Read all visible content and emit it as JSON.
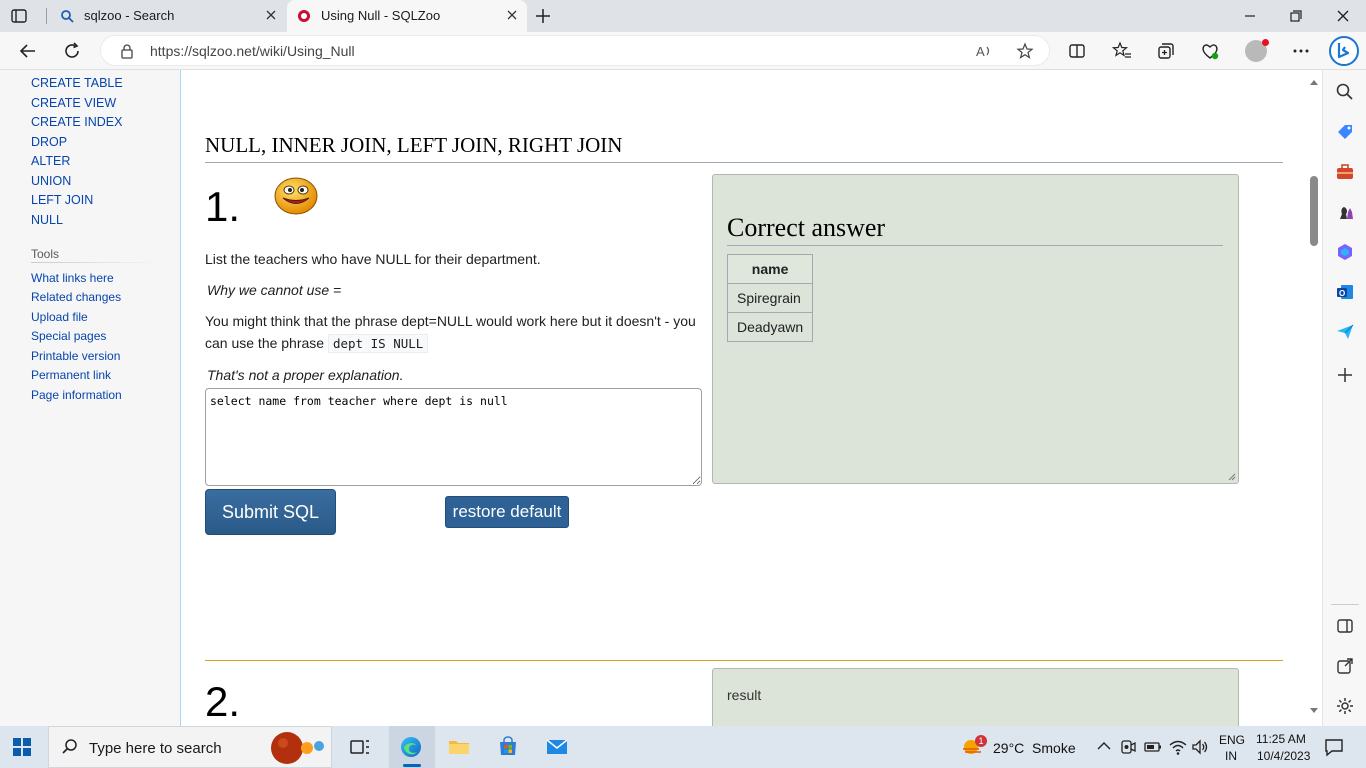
{
  "browser": {
    "tabs": [
      {
        "title": "sqlzoo - Search",
        "active": false
      },
      {
        "title": "Using Null - SQLZoo",
        "active": true
      }
    ],
    "url": "https://sqlzoo.net/wiki/Using_Null"
  },
  "left_nav": {
    "links": [
      "CREATE TABLE",
      "CREATE VIEW",
      "CREATE INDEX",
      "DROP",
      "ALTER",
      "UNION",
      "LEFT JOIN",
      "NULL"
    ],
    "tools_title": "Tools",
    "tools": [
      "What links here",
      "Related changes",
      "Upload file",
      "Special pages",
      "Printable version",
      "Permanent link",
      "Page information"
    ]
  },
  "content": {
    "section_title": "NULL, INNER JOIN, LEFT JOIN, RIGHT JOIN",
    "q1": {
      "number": "1.",
      "prompt": "List the teachers who have NULL for their department.",
      "why_label": "Why we cannot use =",
      "explanation_part1": "You might think that the phrase dept=NULL would work here but it doesn't - you can use the phrase",
      "explanation_code": "dept IS NULL",
      "not_proper": "That's not a proper explanation.",
      "sql": "select name from teacher where dept is null",
      "submit_label": "Submit SQL",
      "restore_label": "restore default",
      "answer": {
        "title": "Correct answer",
        "header": "name",
        "rows": [
          "Spiregrain",
          "Deadyawn"
        ]
      }
    },
    "q2": {
      "number": "2.",
      "result_label": "result"
    }
  },
  "taskbar": {
    "search_placeholder": "Type here to search",
    "weather": "29°C  Smoke",
    "weather_badge": "1",
    "lang": "ENG",
    "region": "IN",
    "time": "11:25 AM",
    "date": "10/4/2023"
  },
  "colors": {
    "link": "#0645ad",
    "answer_bg": "#dce3d8",
    "button": "#2e6297",
    "accent": "#0067c0"
  }
}
